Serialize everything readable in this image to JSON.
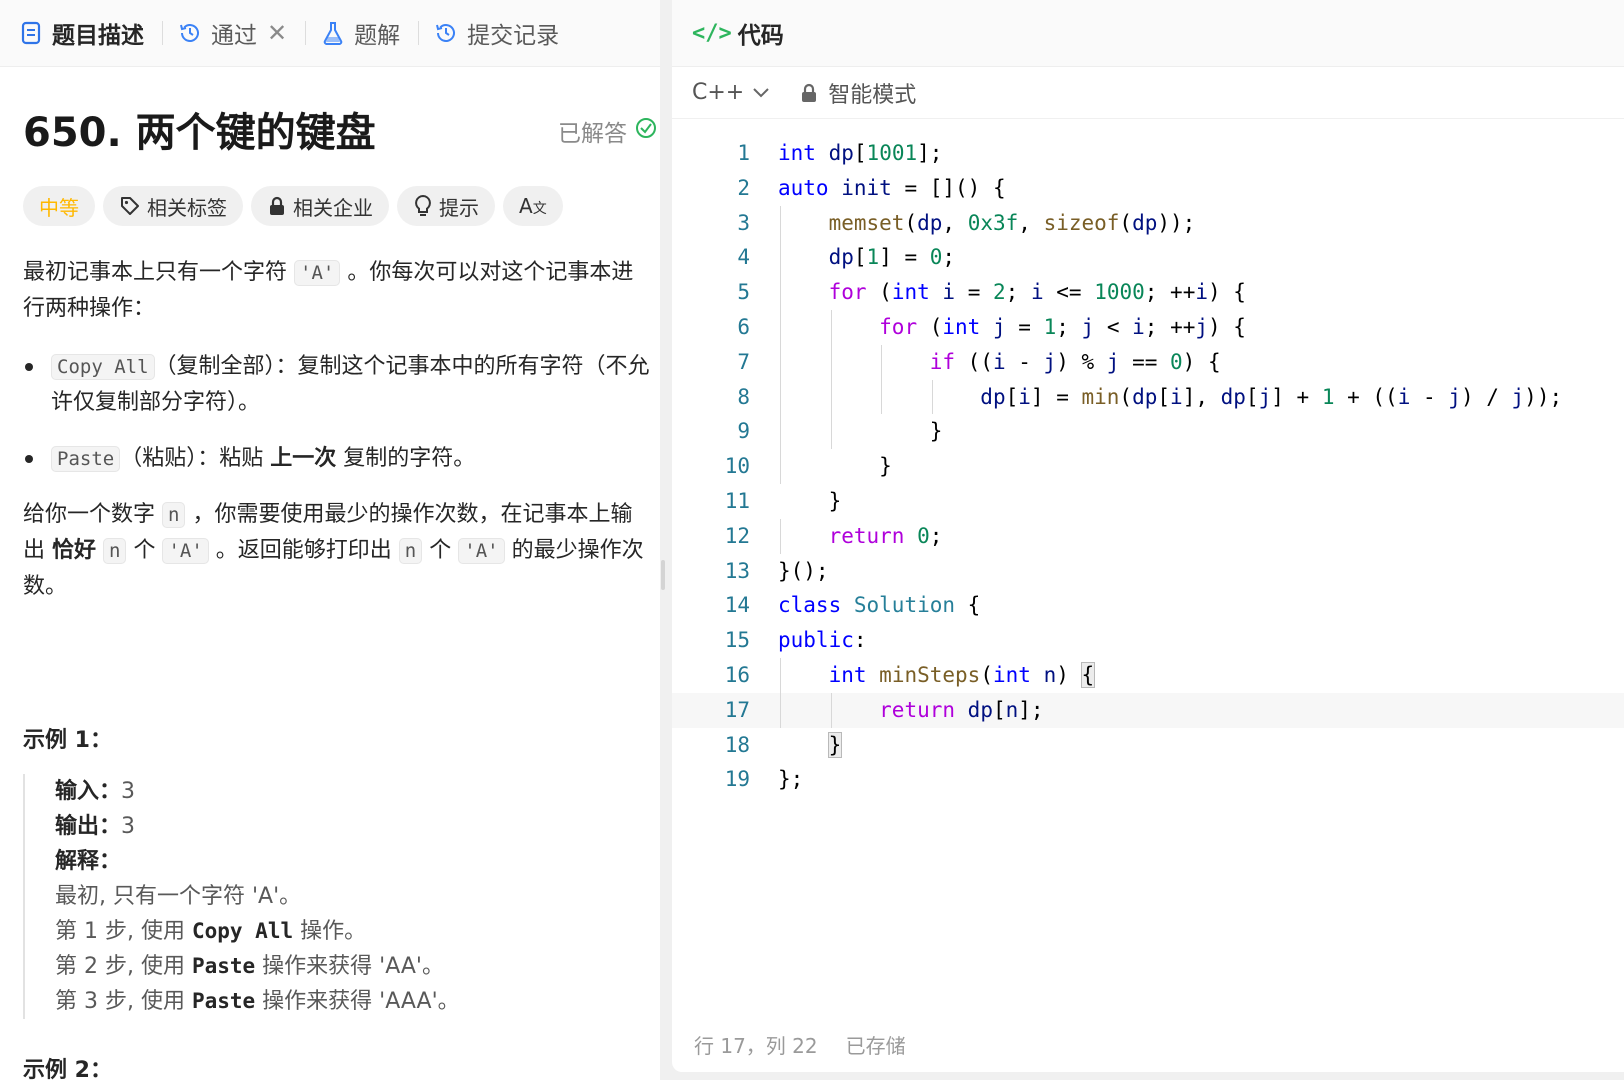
{
  "tabs": [
    {
      "label": "题目描述"
    },
    {
      "label": "通过"
    },
    {
      "label": "题解"
    },
    {
      "label": "提交记录"
    }
  ],
  "problem": {
    "title": "650. 两个键的键盘",
    "solved_label": "已解答"
  },
  "chips": {
    "difficulty": "中等",
    "tags": "相关标签",
    "companies": "相关企业",
    "hint": "提示"
  },
  "description": {
    "p1_a": "最初记事本上只有一个字符 ",
    "p1_code": "'A'",
    "p1_b": " 。你每次可以对这个记事本进行两种操作：",
    "op1_code": "Copy All",
    "op1_text": "（复制全部）：复制这个记事本中的所有字符（不允许仅复制部分字符）。",
    "op2_code": "Paste",
    "op2_text_a": "（粘贴）：粘贴 ",
    "op2_bold": "上一次",
    "op2_text_b": " 复制的字符。",
    "p2_a": "给你一个数字 ",
    "p2_code1": "n",
    "p2_b": " ，你需要使用最少的操作次数，在记事本上输出 ",
    "p2_bold": "恰好",
    "p2_code2": "n",
    "p2_c": " 个 ",
    "p2_code3": "'A'",
    "p2_d": " 。返回能够打印出 ",
    "p2_code4": "n",
    "p2_e": " 个 ",
    "p2_code5": "'A'",
    "p2_f": " 的最少操作次数。"
  },
  "example1": {
    "title": "示例 1：",
    "input_label": "输入：",
    "input_value": "3",
    "output_label": "输出：",
    "output_value": "3",
    "explain_label": "解释：",
    "l1": "最初, 只有一个字符 'A'。",
    "l2_a": "第 1 步, 使用 ",
    "l2_b": "Copy All",
    "l2_c": " 操作。",
    "l3_a": "第 2 步, 使用 ",
    "l3_b": "Paste",
    "l3_c": " 操作来获得 'AA'。",
    "l4_a": "第 3 步, 使用 ",
    "l4_b": "Paste",
    "l4_c": " 操作来获得 'AAA'。"
  },
  "example2": {
    "title": "示例 2："
  },
  "code_panel": {
    "title": "代码",
    "language": "C++",
    "mode": "智能模式"
  },
  "code_lines": [
    "int dp[1001];",
    "auto init = []() {",
    "    memset(dp, 0x3f, sizeof(dp));",
    "    dp[1] = 0;",
    "    for (int i = 2; i <= 1000; ++i) {",
    "        for (int j = 1; j < i; ++j) {",
    "            if ((i - j) % j == 0) {",
    "                dp[i] = min(dp[i], dp[j] + 1 + ((i - j) / j));",
    "            }",
    "        }",
    "    }",
    "    return 0;",
    "}();",
    "class Solution {",
    "public:",
    "    int minSteps(int n) {",
    "        return dp[n];",
    "    }",
    "};"
  ],
  "status": {
    "position": "行 17，列 22",
    "saved": "已存储"
  },
  "colors": {
    "difficulty_medium": "#ffb800",
    "accent_green": "#2db55d",
    "keyword": "#0000ff",
    "control": "#af00db",
    "function": "#795e26",
    "number": "#098658",
    "type": "#267f99",
    "line_number": "#237893"
  }
}
